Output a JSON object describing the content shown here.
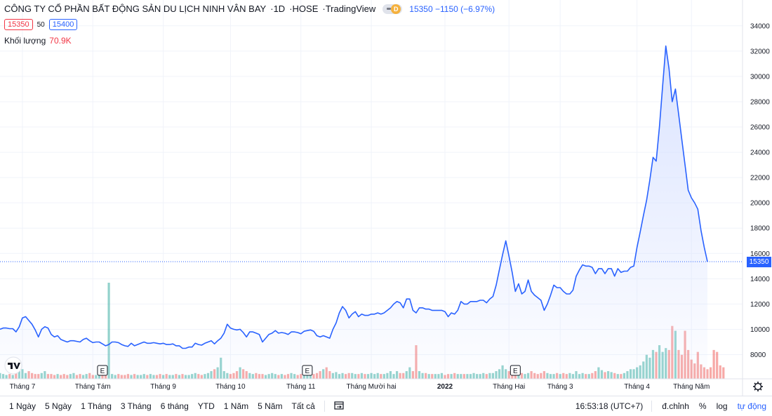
{
  "header": {
    "symbol_name": "CÔNG TY CỔ PHẦN BẤT ĐỘNG SẢN DU LỊCH NINH VÂN BAY",
    "interval": "1D",
    "exchange": "HOSE",
    "source": "TradingView",
    "badge_letter": "D",
    "last_price": "15350",
    "change": "−1150 (−6.97%)"
  },
  "quote": {
    "bid": "15350",
    "spread": "50",
    "ask": "15400"
  },
  "volume": {
    "label": "Khối lượng",
    "value": "70.9K"
  },
  "price_tag": "15350",
  "bottom_bar": {
    "ranges": [
      "1 Ngày",
      "5 Ngày",
      "1 Tháng",
      "3 Tháng",
      "6 tháng",
      "YTD",
      "1 Năm",
      "5 Năm",
      "Tất cả"
    ],
    "time": "16:53:18 (UTC+7)",
    "adjust": "đ.chỉnh",
    "percent": "%",
    "log": "log",
    "auto": "tự động"
  },
  "colors": {
    "line": "#2962ff",
    "area": "#d6e0ff",
    "vol_up": "#26a69a",
    "vol_down": "#ef5350",
    "grid": "#f0f3fa"
  },
  "chart_data": {
    "type": "line",
    "title": "",
    "ylim": [
      7000,
      35000
    ],
    "y_ticks": [
      8000,
      10000,
      12000,
      14000,
      16000,
      18000,
      20000,
      22000,
      24000,
      26000,
      28000,
      30000,
      32000,
      34000
    ],
    "x_ticks": [
      {
        "label": "Tháng 7",
        "day": 7
      },
      {
        "label": "Tháng Tám",
        "day": 29
      },
      {
        "label": "Tháng 9",
        "day": 51
      },
      {
        "label": "Tháng 10",
        "day": 72
      },
      {
        "label": "Tháng 11",
        "day": 94
      },
      {
        "label": "Tháng Mười hai",
        "day": 116
      },
      {
        "label": "2022",
        "day": 139
      },
      {
        "label": "Tháng Hai",
        "day": 159
      },
      {
        "label": "Tháng 3",
        "day": 175
      },
      {
        "label": "Tháng 4",
        "day": 199
      },
      {
        "label": "Tháng Năm",
        "day": 216
      }
    ],
    "earnings_days": [
      32,
      96,
      161
    ],
    "series": [
      {
        "values": [
          10000,
          10100,
          10100,
          10050,
          10050,
          9800,
          10200,
          10900,
          11000,
          10700,
          10400,
          9950,
          9400,
          10000,
          10200,
          10100,
          9600,
          9400,
          9500,
          9200,
          9100,
          9000,
          9100,
          9100,
          9050,
          9000,
          9200,
          9300,
          9100,
          8950,
          9000,
          9000,
          8850,
          8700,
          8800,
          9000,
          9000,
          8950,
          8800,
          8700,
          8650,
          8900,
          8700,
          8800,
          8900,
          9000,
          8900,
          8900,
          8950,
          8900,
          8850,
          8900,
          8800,
          8800,
          8850,
          8700,
          8700,
          8500,
          8500,
          8600,
          8600,
          8900,
          8800,
          8750,
          8900,
          9000,
          9100,
          8850,
          9100,
          9300,
          9700,
          10400,
          10100,
          10000,
          9950,
          10000,
          9750,
          9400,
          9800,
          9800,
          9700,
          9600,
          9000,
          9300,
          9600,
          9700,
          9900,
          9700,
          9750,
          9700,
          9600,
          9800,
          9800,
          9750,
          9650,
          9850,
          9900,
          9950,
          9850,
          9500,
          9400,
          9500,
          9400,
          9300,
          10000,
          10500,
          11300,
          11800,
          11500,
          10900,
          11200,
          11400,
          11000,
          11200,
          11100,
          11100,
          11200,
          11200,
          11300,
          11200,
          11300,
          11500,
          11700,
          12000,
          12200,
          12100,
          11700,
          12400,
          12400,
          11500,
          11300,
          11700,
          11700,
          11600,
          11600,
          11500,
          11500,
          11500,
          11500,
          11400,
          11000,
          11300,
          11200,
          11500,
          12200,
          12000,
          12000,
          12200,
          12200,
          12200,
          12300,
          12300,
          12100,
          12400,
          12600,
          13500,
          14700,
          15900,
          17000,
          15800,
          14500,
          13000,
          13600,
          12800,
          13000,
          13900,
          13000,
          12700,
          12500,
          12300,
          11500,
          12000,
          12700,
          13500,
          13300,
          13300,
          13000,
          12800,
          12800,
          13100,
          14200,
          14700,
          15100,
          15000,
          15000,
          14900,
          14400,
          14800,
          14800,
          14400,
          14800,
          14800,
          14200,
          14800,
          14500,
          14600,
          14600,
          14900,
          15000,
          16500,
          17700,
          19000,
          20200,
          21800,
          23600,
          23300,
          26000,
          29200,
          32400,
          30600,
          28000,
          29000,
          27000,
          25000,
          23000,
          21000,
          20400,
          20000,
          19500,
          17800,
          16500,
          15350
        ]
      }
    ],
    "volume": [
      0.06,
      0.05,
      0.04,
      0.05,
      0.04,
      0.07,
      0.08,
      0.1,
      0.06,
      0.08,
      0.06,
      0.05,
      0.05,
      0.06,
      0.08,
      0.05,
      0.05,
      0.04,
      0.05,
      0.04,
      0.05,
      0.04,
      0.05,
      0.06,
      0.04,
      0.05,
      0.04,
      0.05,
      0.06,
      0.04,
      0.04,
      0.05,
      0.04,
      0.05,
      1.0,
      0.05,
      0.04,
      0.05,
      0.04,
      0.04,
      0.05,
      0.04,
      0.05,
      0.04,
      0.04,
      0.05,
      0.04,
      0.05,
      0.04,
      0.04,
      0.05,
      0.04,
      0.05,
      0.04,
      0.04,
      0.05,
      0.04,
      0.05,
      0.04,
      0.04,
      0.05,
      0.06,
      0.05,
      0.04,
      0.05,
      0.06,
      0.08,
      0.1,
      0.12,
      0.22,
      0.08,
      0.06,
      0.05,
      0.06,
      0.08,
      0.12,
      0.1,
      0.08,
      0.06,
      0.05,
      0.06,
      0.05,
      0.05,
      0.04,
      0.05,
      0.06,
      0.05,
      0.04,
      0.05,
      0.04,
      0.05,
      0.06,
      0.05,
      0.04,
      0.05,
      0.04,
      0.05,
      0.04,
      0.05,
      0.06,
      0.08,
      0.1,
      0.12,
      0.08,
      0.06,
      0.07,
      0.05,
      0.06,
      0.05,
      0.06,
      0.06,
      0.05,
      0.05,
      0.06,
      0.05,
      0.05,
      0.06,
      0.05,
      0.06,
      0.05,
      0.05,
      0.06,
      0.08,
      0.05,
      0.08,
      0.06,
      0.06,
      0.08,
      0.12,
      0.08,
      0.35,
      0.08,
      0.06,
      0.06,
      0.05,
      0.05,
      0.05,
      0.05,
      0.06,
      0.04,
      0.05,
      0.05,
      0.06,
      0.05,
      0.05,
      0.05,
      0.05,
      0.05,
      0.06,
      0.05,
      0.05,
      0.06,
      0.05,
      0.06,
      0.06,
      0.08,
      0.1,
      0.14,
      0.1,
      0.08,
      0.07,
      0.06,
      0.05,
      0.06,
      0.05,
      0.06,
      0.08,
      0.06,
      0.05,
      0.06,
      0.08,
      0.06,
      0.05,
      0.05,
      0.06,
      0.05,
      0.06,
      0.05,
      0.06,
      0.05,
      0.08,
      0.05,
      0.06,
      0.05,
      0.05,
      0.06,
      0.08,
      0.12,
      0.09,
      0.07,
      0.08,
      0.07,
      0.06,
      0.05,
      0.05,
      0.06,
      0.08,
      0.1,
      0.1,
      0.12,
      0.14,
      0.18,
      0.25,
      0.22,
      0.3,
      0.28,
      0.35,
      0.28,
      0.32,
      0.3,
      0.55,
      0.5,
      0.3,
      0.25,
      0.5,
      0.3,
      0.2,
      0.16,
      0.28,
      0.15,
      0.12,
      0.1,
      0.12,
      0.3,
      0.28,
      0.14,
      0.12
    ]
  }
}
